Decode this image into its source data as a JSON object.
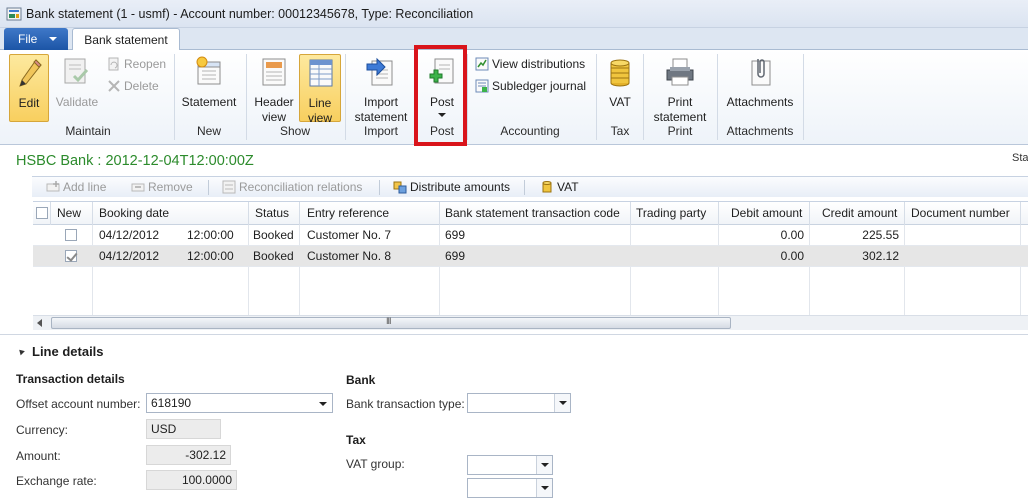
{
  "window": {
    "title": "Bank statement (1 - usmf) - Account number: 00012345678, Type: Reconciliation"
  },
  "ribbon": {
    "file_tab": "File",
    "active_tab": "Bank statement",
    "groups": {
      "maintain": {
        "label": "Maintain",
        "edit": "Edit",
        "validate": "Validate",
        "reopen": "Reopen",
        "delete": "Delete"
      },
      "new": {
        "label": "New",
        "statement": "Statement"
      },
      "show": {
        "label": "Show",
        "header_view": "Header view",
        "line_view": "Line view"
      },
      "import": {
        "label": "Import",
        "import_statement": "Import statement"
      },
      "post": {
        "label": "Post",
        "post": "Post"
      },
      "accounting": {
        "label": "Accounting",
        "view_distributions": "View distributions",
        "subledger_journal": "Subledger journal"
      },
      "tax": {
        "label": "Tax",
        "vat": "VAT"
      },
      "print": {
        "label": "Print",
        "print_statement": "Print statement"
      },
      "attachments": {
        "label": "Attachments",
        "attachments": "Attachments"
      }
    },
    "highlight_color": "#d9141b"
  },
  "form": {
    "title": "HSBC Bank : 2012-12-04T12:00:00Z",
    "title_color": "#2c8b2c",
    "right_text": "Sta"
  },
  "actions": {
    "add_line": "Add line",
    "remove": "Remove",
    "reconciliation_relations": "Reconciliation relations",
    "distribute_amounts": "Distribute amounts",
    "vat": "VAT"
  },
  "grid": {
    "columns": {
      "new": "New",
      "booking_date": "Booking date",
      "status": "Status",
      "entry_reference": "Entry reference",
      "transaction_code": "Bank statement transaction code",
      "trading_party": "Trading party",
      "debit_amount": "Debit amount",
      "credit_amount": "Credit amount",
      "document_number": "Document number"
    },
    "rows": [
      {
        "new": false,
        "date": "04/12/2012",
        "time": "12:00:00",
        "status": "Booked",
        "entry_reference": "Customer No. 7",
        "transaction_code": "699",
        "trading_party": "",
        "debit_amount": "0.00",
        "credit_amount": "225.55",
        "document_number": ""
      },
      {
        "new": true,
        "date": "04/12/2012",
        "time": "12:00:00",
        "status": "Booked",
        "entry_reference": "Customer No. 8",
        "transaction_code": "699",
        "trading_party": "",
        "debit_amount": "0.00",
        "credit_amount": "302.12",
        "document_number": ""
      }
    ],
    "scroll_grip": "III"
  },
  "line_details": {
    "title": "Line details",
    "transaction_details": {
      "heading": "Transaction details",
      "offset_account_label": "Offset account number:",
      "offset_account_value": "618190",
      "currency_label": "Currency:",
      "currency_value": "USD",
      "amount_label": "Amount:",
      "amount_value": "-302.12",
      "exchange_rate_label": "Exchange rate:",
      "exchange_rate_value": "100.0000"
    },
    "bank": {
      "heading": "Bank",
      "bank_transaction_type_label": "Bank transaction type:",
      "bank_transaction_type_value": ""
    },
    "tax": {
      "heading": "Tax",
      "vat_group_label": "VAT group:",
      "vat_group_value": "",
      "item_vat_group_value": ""
    }
  }
}
